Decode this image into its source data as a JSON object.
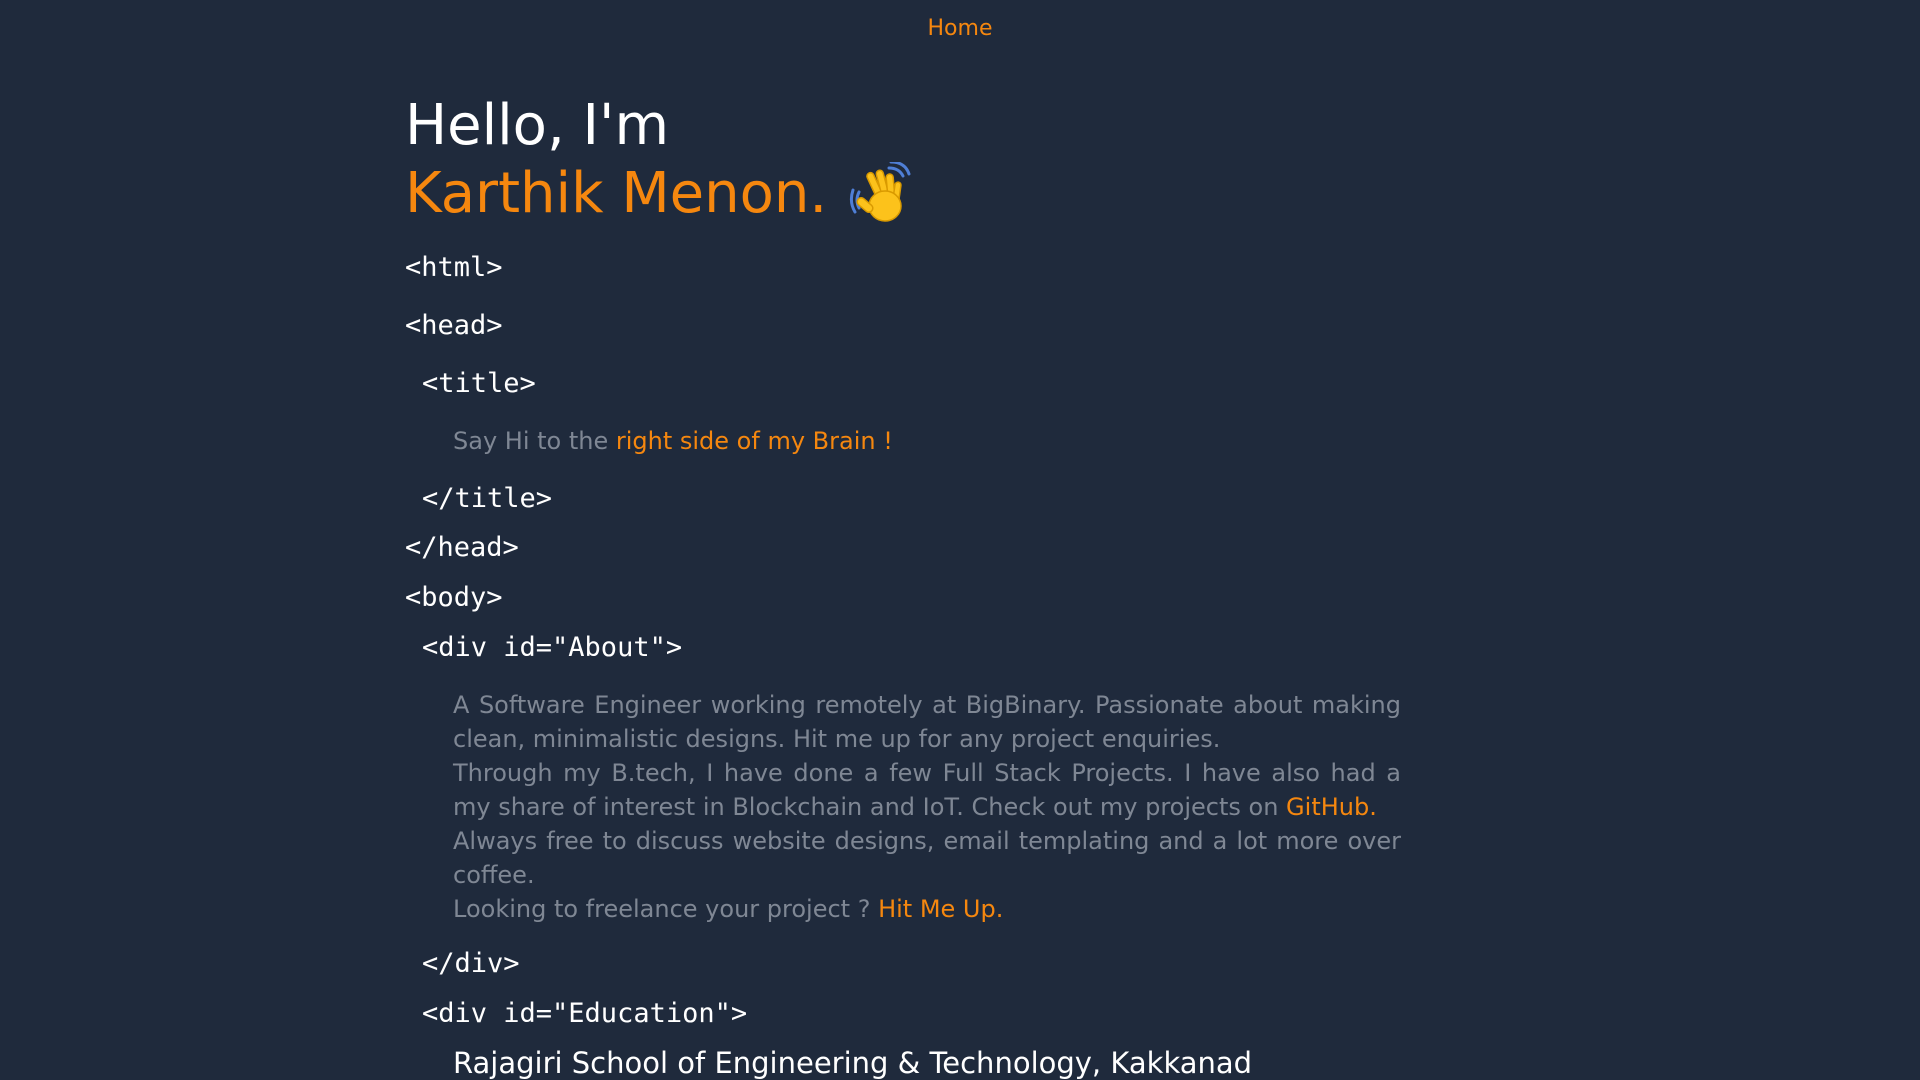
{
  "nav": {
    "home": "Home"
  },
  "hero": {
    "greeting": "Hello, I'm",
    "name": "Karthik Menon.",
    "wave_icon": "waving-hand-icon"
  },
  "code": {
    "html_open": "<html>",
    "head_open": "<head>",
    "title_open": "<title>",
    "title_close": "</title>",
    "head_close": "</head>",
    "body_open": "<body>",
    "about_open": "<div id=\"About\">",
    "div_close": "</div>",
    "education_open": "<div id=\"Education\">"
  },
  "title_text": {
    "prefix": "Say Hi to the ",
    "highlight": "right side of my Brain !"
  },
  "about": {
    "line1": "A Software Engineer working remotely at BigBinary. Passionate about making clean, minimalistic designs. Hit me up for any project enquiries.",
    "line2": "Through my B.tech, I have done a few Full Stack Projects. I have also had a my share of interest in Blockchain and IoT. Check out my projects on ",
    "github_link": "GitHub.",
    "line3": "Always free to discuss website designs, email templating and a lot more over coffee.",
    "line4": "Looking to freelance your project ? ",
    "hire_link": "Hit Me Up."
  },
  "education": {
    "school": "Rajagiri School of Engineering & Technology, Kakkanad"
  },
  "colors": {
    "background": "#1f2a3c",
    "accent": "#f5870f",
    "muted_text": "#7f8794"
  }
}
